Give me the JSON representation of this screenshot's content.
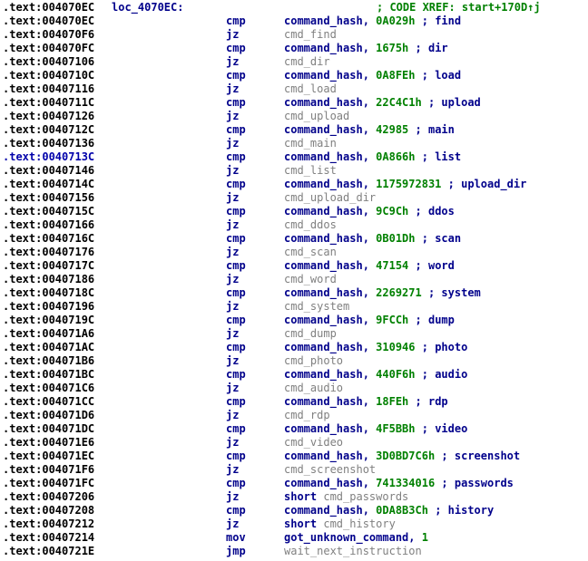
{
  "header": {
    "address": ".text:004070EC",
    "label": "loc_4070EC:",
    "xref": "; CODE XREF: start+170D↑j"
  },
  "rows": [
    {
      "addr": ".text:004070EC",
      "mnem": "cmp",
      "kind": "cmp",
      "reg": "command_hash,",
      "value": "0A029h",
      "comment": "; find"
    },
    {
      "addr": ".text:004070F6",
      "mnem": "jz",
      "kind": "jmp",
      "target": "cmd_find"
    },
    {
      "addr": ".text:004070FC",
      "mnem": "cmp",
      "kind": "cmp",
      "reg": "command_hash,",
      "value": "1675h",
      "comment": "; dir"
    },
    {
      "addr": ".text:00407106",
      "mnem": "jz",
      "kind": "jmp",
      "target": "cmd_dir"
    },
    {
      "addr": ".text:0040710C",
      "mnem": "cmp",
      "kind": "cmp",
      "reg": "command_hash,",
      "value": "0A8FEh",
      "comment": "; load"
    },
    {
      "addr": ".text:00407116",
      "mnem": "jz",
      "kind": "jmp",
      "target": "cmd_load"
    },
    {
      "addr": ".text:0040711C",
      "mnem": "cmp",
      "kind": "cmp",
      "reg": "command_hash,",
      "value": "22C4C1h",
      "comment": "; upload"
    },
    {
      "addr": ".text:00407126",
      "mnem": "jz",
      "kind": "jmp",
      "target": "cmd_upload"
    },
    {
      "addr": ".text:0040712C",
      "mnem": "cmp",
      "kind": "cmp",
      "reg": "command_hash,",
      "value": "42985",
      "comment": "; main"
    },
    {
      "addr": ".text:00407136",
      "mnem": "jz",
      "kind": "jmp",
      "target": "cmd_main"
    },
    {
      "addr": ".text:0040713C",
      "mnem": "cmp",
      "kind": "cmp",
      "reg": "command_hash,",
      "value": "0A866h",
      "comment": "; list",
      "addr_blue": true
    },
    {
      "addr": ".text:00407146",
      "mnem": "jz",
      "kind": "jmp",
      "target": "cmd_list"
    },
    {
      "addr": ".text:0040714C",
      "mnem": "cmp",
      "kind": "cmp",
      "reg": "command_hash,",
      "value": "1175972831",
      "comment": "; upload_dir"
    },
    {
      "addr": ".text:00407156",
      "mnem": "jz",
      "kind": "jmp",
      "target": "cmd_upload_dir"
    },
    {
      "addr": ".text:0040715C",
      "mnem": "cmp",
      "kind": "cmp",
      "reg": "command_hash,",
      "value": "9C9Ch",
      "comment": "; ddos"
    },
    {
      "addr": ".text:00407166",
      "mnem": "jz",
      "kind": "jmp",
      "target": "cmd_ddos"
    },
    {
      "addr": ".text:0040716C",
      "mnem": "cmp",
      "kind": "cmp",
      "reg": "command_hash,",
      "value": "0B01Dh",
      "comment": "; scan"
    },
    {
      "addr": ".text:00407176",
      "mnem": "jz",
      "kind": "jmp",
      "target": "cmd_scan"
    },
    {
      "addr": ".text:0040717C",
      "mnem": "cmp",
      "kind": "cmp",
      "reg": "command_hash,",
      "value": "47154",
      "comment": "; word"
    },
    {
      "addr": ".text:00407186",
      "mnem": "jz",
      "kind": "jmp",
      "target": "cmd_word"
    },
    {
      "addr": ".text:0040718C",
      "mnem": "cmp",
      "kind": "cmp",
      "reg": "command_hash,",
      "value": "2269271",
      "comment": "; system"
    },
    {
      "addr": ".text:00407196",
      "mnem": "jz",
      "kind": "jmp",
      "target": "cmd_system"
    },
    {
      "addr": ".text:0040719C",
      "mnem": "cmp",
      "kind": "cmp",
      "reg": "command_hash,",
      "value": "9FCCh",
      "comment": "; dump"
    },
    {
      "addr": ".text:004071A6",
      "mnem": "jz",
      "kind": "jmp",
      "target": "cmd_dump"
    },
    {
      "addr": ".text:004071AC",
      "mnem": "cmp",
      "kind": "cmp",
      "reg": "command_hash,",
      "value": "310946",
      "comment": "; photo"
    },
    {
      "addr": ".text:004071B6",
      "mnem": "jz",
      "kind": "jmp",
      "target": "cmd_photo"
    },
    {
      "addr": ".text:004071BC",
      "mnem": "cmp",
      "kind": "cmp",
      "reg": "command_hash,",
      "value": "440F6h",
      "comment": "; audio"
    },
    {
      "addr": ".text:004071C6",
      "mnem": "jz",
      "kind": "jmp",
      "target": "cmd_audio"
    },
    {
      "addr": ".text:004071CC",
      "mnem": "cmp",
      "kind": "cmp",
      "reg": "command_hash,",
      "value": "18FEh",
      "comment": "; rdp"
    },
    {
      "addr": ".text:004071D6",
      "mnem": "jz",
      "kind": "jmp",
      "target": "cmd_rdp"
    },
    {
      "addr": ".text:004071DC",
      "mnem": "cmp",
      "kind": "cmp",
      "reg": "command_hash,",
      "value": "4F5BBh",
      "comment": "; video"
    },
    {
      "addr": ".text:004071E6",
      "mnem": "jz",
      "kind": "jmp",
      "target": "cmd_video"
    },
    {
      "addr": ".text:004071EC",
      "mnem": "cmp",
      "kind": "cmp",
      "reg": "command_hash,",
      "value": "3D0BD7C6h",
      "comment": "; screenshot"
    },
    {
      "addr": ".text:004071F6",
      "mnem": "jz",
      "kind": "jmp",
      "target": "cmd_screenshot"
    },
    {
      "addr": ".text:004071FC",
      "mnem": "cmp",
      "kind": "cmp",
      "reg": "command_hash,",
      "value": "741334016",
      "comment": "; passwords"
    },
    {
      "addr": ".text:00407206",
      "mnem": "jz",
      "kind": "jmp",
      "prefix": "short",
      "target": "cmd_passwords"
    },
    {
      "addr": ".text:00407208",
      "mnem": "cmp",
      "kind": "cmp",
      "reg": "command_hash,",
      "value": "0DA8B3Ch",
      "comment": "; history"
    },
    {
      "addr": ".text:00407212",
      "mnem": "jz",
      "kind": "jmp",
      "prefix": "short",
      "target": "cmd_history"
    },
    {
      "addr": ".text:00407214",
      "mnem": "mov",
      "kind": "mov",
      "reg": "got_unknown_command,",
      "value": "1"
    },
    {
      "addr": ".text:0040721E",
      "mnem": "jmp",
      "kind": "jmp",
      "target": "wait_next_instruction"
    }
  ]
}
